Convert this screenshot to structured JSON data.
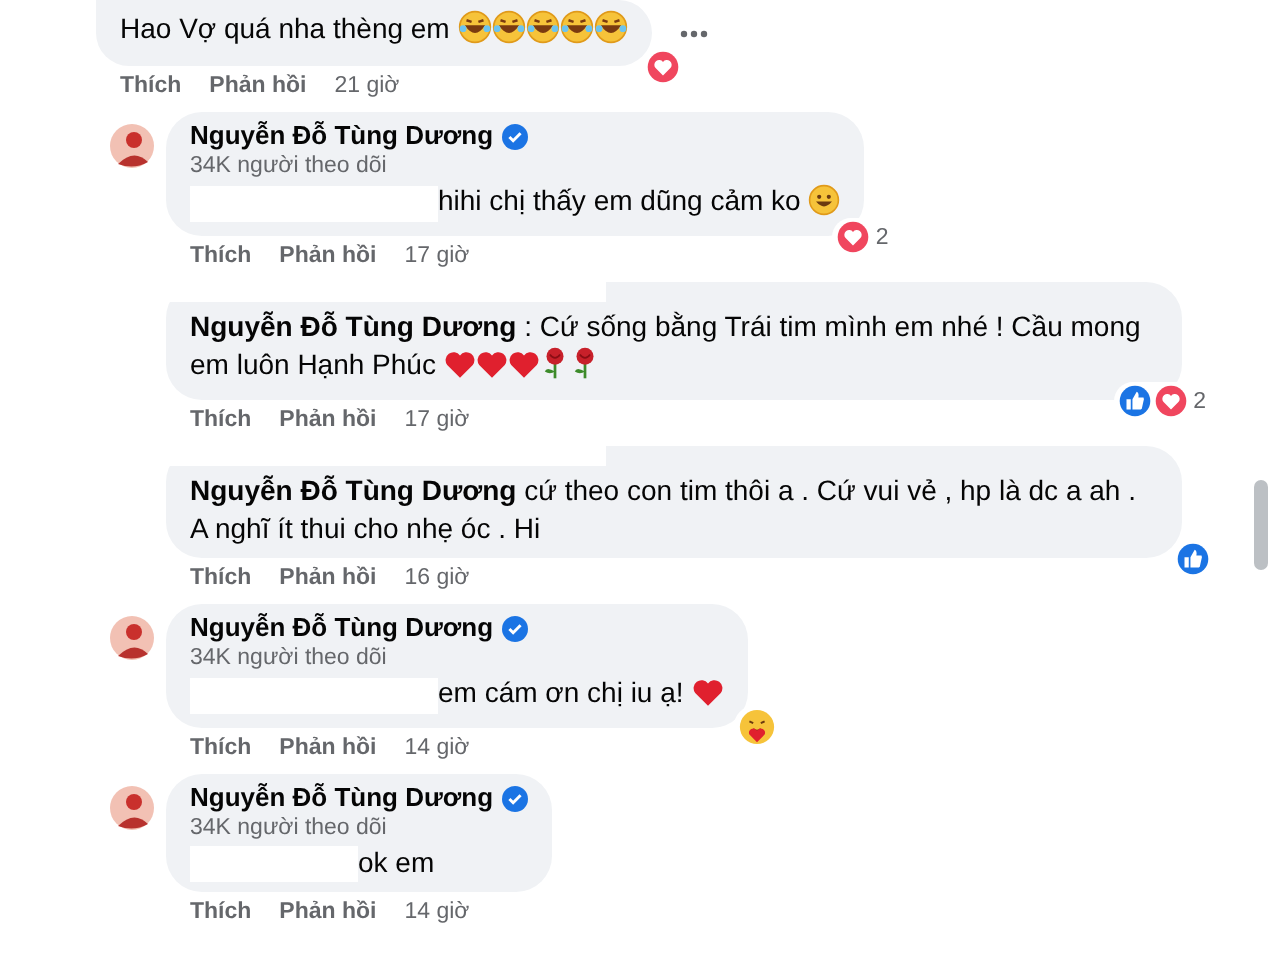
{
  "comments": [
    {
      "text": "Hao Vợ quá nha thèng em",
      "emojis": [
        {
          "kind": "laugh"
        },
        {
          "kind": "laugh"
        },
        {
          "kind": "laugh"
        },
        {
          "kind": "laugh"
        },
        {
          "kind": "laugh"
        }
      ],
      "reactions": [
        {
          "kind": "love"
        }
      ],
      "more": true,
      "like": "Thích",
      "reply": "Phản hồi",
      "time": "21 giờ"
    },
    {
      "avatar": true,
      "author": "Nguyễn Đỗ Tùng Dương",
      "verified": true,
      "followers": "34K người theo dõi",
      "redacted": true,
      "text": "hihi chị thấy em dũng cảm ko",
      "emojis": [
        {
          "kind": "smile"
        }
      ],
      "reactions": [
        {
          "kind": "love"
        }
      ],
      "reaction_count": "2",
      "like": "Thích",
      "reply": "Phản hồi",
      "time": "17 giờ"
    },
    {
      "redacted_top": true,
      "text": "**Nguyễn Đỗ Tùng Dương** : Cứ sống bằng Trái tim mình em nhé ! Cầu mong em luôn Hạnh Phúc",
      "emojis": [
        {
          "kind": "heart"
        },
        {
          "kind": "heart"
        },
        {
          "kind": "heart"
        },
        {
          "kind": "rose"
        },
        {
          "kind": "rose"
        }
      ],
      "reactions": [
        {
          "kind": "like"
        },
        {
          "kind": "love"
        }
      ],
      "reaction_count": "2",
      "like": "Thích",
      "reply": "Phản hồi",
      "time": "17 giờ"
    },
    {
      "redacted_top": true,
      "text": "**Nguyễn Đỗ Tùng Dương** cứ theo con tim thôi a . Cứ vui vẻ , hp là dc a ah . A nghĩ ít thui cho nhẹ óc . Hi",
      "reactions": [
        {
          "kind": "like"
        }
      ],
      "like": "Thích",
      "reply": "Phản hồi",
      "time": "16 giờ"
    },
    {
      "avatar": true,
      "author": "Nguyễn Đỗ Tùng Dương",
      "verified": true,
      "followers": "34K người theo dõi",
      "redacted": true,
      "text": "em cám ơn chị iu ạ!",
      "emojis": [
        {
          "kind": "heart"
        }
      ],
      "reactions": [
        {
          "kind": "care"
        }
      ],
      "like": "Thích",
      "reply": "Phản hồi",
      "time": "14 giờ"
    },
    {
      "avatar": true,
      "author": "Nguyễn Đỗ Tùng Dương",
      "verified": true,
      "followers": "34K người theo dõi",
      "redacted": true,
      "text": "ok em",
      "like": "Thích",
      "reply": "Phản hồi",
      "time": "14 giờ"
    }
  ]
}
